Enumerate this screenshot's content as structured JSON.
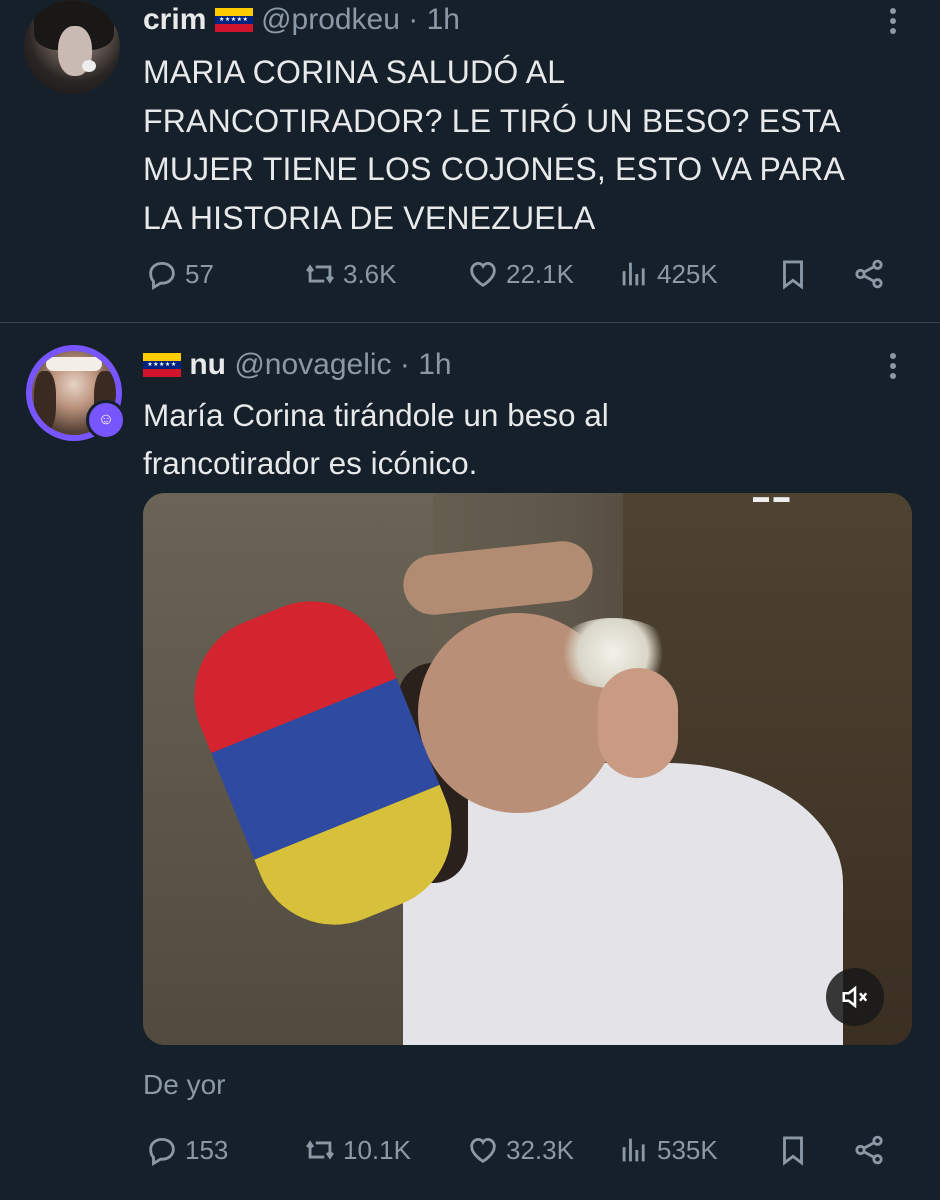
{
  "tweets": [
    {
      "name": "crim",
      "handle": "@prodkeu",
      "separator": "·",
      "time": "1h",
      "text": "MARIA CORINA SALUDÓ AL FRANCOTIRADOR? LE TIRÓ UN BESO? ESTA MUJER TIENE LOS COJONES, ESTO VA PARA LA HISTORIA DE VENEZUELA",
      "text_lines": [
        "MARIA CORINA SALUDÓ AL",
        "FRANCOTIRADOR? LE TIRÓ UN BESO? ESTA",
        "MUJER TIENE LOS COJONES, ESTO VA PARA",
        "LA HISTORIA DE VENEZUELA"
      ],
      "stats": {
        "replies": "57",
        "reposts": "3.6K",
        "likes": "22.1K",
        "views": "425K"
      }
    },
    {
      "name": "nu",
      "handle": "@novagelic",
      "separator": "·",
      "time": "1h",
      "text_lines": [
        "María Corina tirándole un beso al",
        "francotirador es icónico."
      ],
      "media_attribution": "De yor",
      "stats": {
        "replies": "153",
        "reposts": "10.1K",
        "likes": "32.3K",
        "views": "535K"
      }
    }
  ],
  "colors": {
    "background": "#15202b",
    "text": "#e7e9ea",
    "muted": "#8b98a5",
    "divider": "#38444d",
    "accent_ring": "#7856ff"
  },
  "icons": [
    "reply-icon",
    "repost-icon",
    "like-icon",
    "views-icon",
    "bookmark-icon",
    "share-icon",
    "more-icon",
    "mute-icon",
    "venezuela-flag-icon"
  ]
}
